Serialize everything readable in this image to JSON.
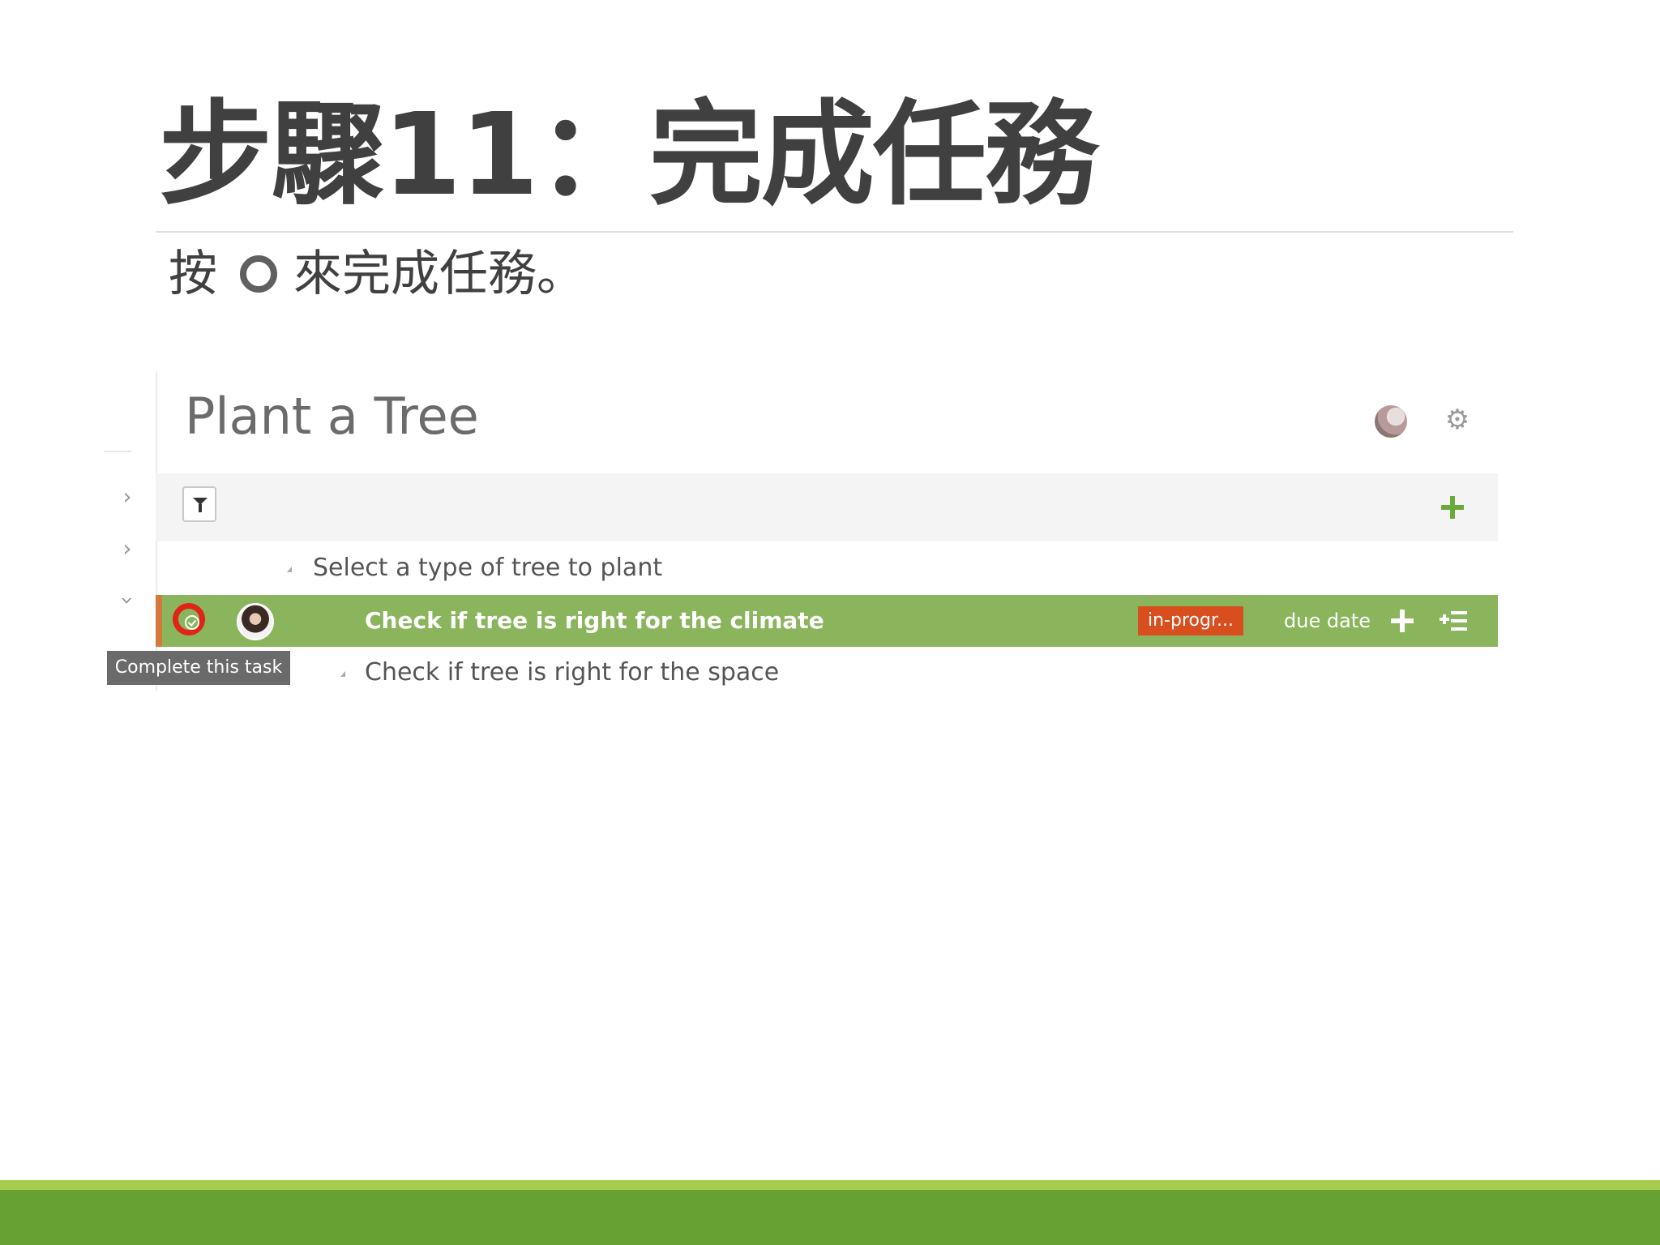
{
  "slide": {
    "title": "步驟11：完成任務",
    "instruction_before": "按",
    "instruction_icon": "circle-icon",
    "instruction_after": "來完成任務。"
  },
  "app": {
    "project_title": "Plant a Tree",
    "rows": [
      {
        "label": "Select a type of tree to plant"
      },
      {
        "label": "Check if tree is right for the climate",
        "status": "in-progr...",
        "due_date": "due date",
        "tooltip": "Complete this task"
      },
      {
        "label": "Check if tree is right for the space"
      }
    ],
    "icons": {
      "toolbar": [
        "filter-icon",
        "plus-icon"
      ],
      "header": [
        "avatar",
        "gear-icon"
      ],
      "row_actions": [
        "complete-check-icon",
        "plus-icon",
        "subtask-list-icon"
      ]
    },
    "colors": {
      "active_row": "#8bb55d",
      "status_badge": "#d84e1f",
      "highlight_ring": "#e02418",
      "accent_green": "#6aaa3a"
    }
  },
  "footer": {
    "band_color": "#67a134",
    "band_light_color": "#a6cc4e"
  }
}
